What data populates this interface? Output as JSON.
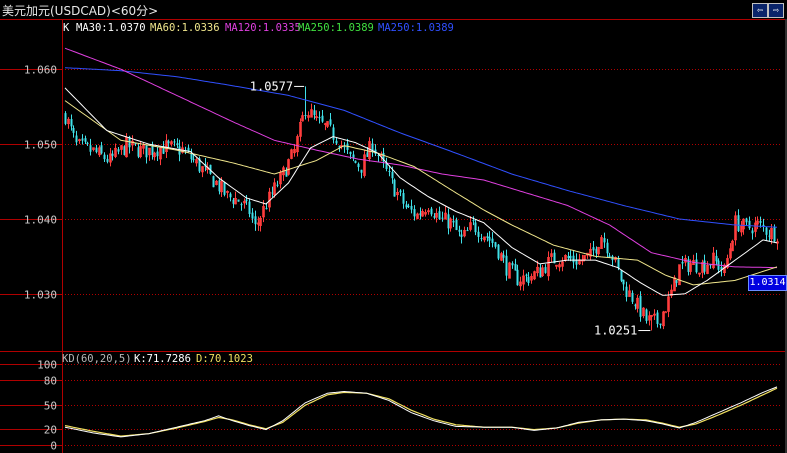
{
  "window": {
    "title": "美元加元(USDCAD)<60分>",
    "btn_prev": "⇦",
    "btn_next": "⇨"
  },
  "colors": {
    "background": "#000000",
    "frame": "#b00000",
    "up_candle": "#ff3d3d",
    "down_candle": "#40e0e8",
    "ma30": "#ffffff",
    "ma60": "#f0e68c",
    "ma120": "#e040e0",
    "ma250": "#3050ff",
    "k_line": "#ffffff",
    "d_line": "#f0e060"
  },
  "main_legend": {
    "prefix": "K",
    "ma30": "MA30:1.0370",
    "ma60": "MA60:1.0336",
    "ma120": "MA120:1.0335",
    "ma250_green": "MA250:1.0389",
    "ma250_blue": "MA250:1.0389"
  },
  "kd_legend": {
    "name": "KD(60,20,5)",
    "k": "K:71.7286",
    "d": "D:70.1023"
  },
  "price_tag": "1.0314",
  "annotations": {
    "high": "1.0577",
    "low": "1.0251"
  },
  "chart_data": [
    {
      "type": "candlestick",
      "title": "",
      "y_ticks": [
        "1.060",
        "1.050",
        "1.040",
        "1.030"
      ],
      "ylim": [
        1.0225,
        1.0643
      ],
      "grid": true,
      "marked_high": 1.0577,
      "marked_low": 1.0251,
      "last_price": 1.0314,
      "close_path_points": [
        [
          0,
          1.0538
        ],
        [
          4,
          1.0498
        ],
        [
          10,
          1.049
        ],
        [
          16,
          1.0478
        ],
        [
          22,
          1.0498
        ],
        [
          28,
          1.049
        ],
        [
          36,
          1.0496
        ],
        [
          42,
          1.0492
        ],
        [
          48,
          1.047
        ],
        [
          54,
          1.0448
        ],
        [
          58,
          1.043
        ],
        [
          62,
          1.0425
        ],
        [
          66,
          1.041
        ],
        [
          68,
          1.0388
        ],
        [
          72,
          1.042
        ],
        [
          78,
          1.046
        ],
        [
          82,
          1.049
        ],
        [
          86,
          1.0548
        ],
        [
          90,
          1.053
        ],
        [
          94,
          1.052
        ],
        [
          98,
          1.0505
        ],
        [
          102,
          1.048
        ],
        [
          106,
          1.047
        ],
        [
          110,
          1.05
        ],
        [
          114,
          1.047
        ],
        [
          118,
          1.044
        ],
        [
          122,
          1.0415
        ],
        [
          126,
          1.0405
        ],
        [
          130,
          1.042
        ],
        [
          134,
          1.04
        ],
        [
          138,
          1.0395
        ],
        [
          142,
          1.0372
        ],
        [
          146,
          1.0392
        ],
        [
          150,
          1.038
        ],
        [
          154,
          1.0365
        ],
        [
          158,
          1.0335
        ],
        [
          162,
          1.032
        ],
        [
          166,
          1.0322
        ],
        [
          170,
          1.033
        ],
        [
          174,
          1.0345
        ],
        [
          178,
          1.0348
        ],
        [
          184,
          1.0344
        ],
        [
          188,
          1.035
        ],
        [
          192,
          1.0378
        ],
        [
          196,
          1.035
        ],
        [
          200,
          1.031
        ],
        [
          204,
          1.029
        ],
        [
          208,
          1.0265
        ],
        [
          212,
          1.0262
        ],
        [
          216,
          1.029
        ],
        [
          220,
          1.0335
        ],
        [
          224,
          1.034
        ],
        [
          228,
          1.0338
        ],
        [
          232,
          1.0345
        ],
        [
          236,
          1.033
        ],
        [
          240,
          1.0395
        ],
        [
          244,
          1.0388
        ],
        [
          248,
          1.0392
        ],
        [
          252,
          1.0383
        ],
        [
          255,
          1.038
        ]
      ],
      "ma30": [
        [
          0,
          1.0575
        ],
        [
          15,
          1.0518
        ],
        [
          30,
          1.05
        ],
        [
          45,
          1.049
        ],
        [
          55,
          1.0455
        ],
        [
          65,
          1.0428
        ],
        [
          72,
          1.042
        ],
        [
          80,
          1.0448
        ],
        [
          88,
          1.0495
        ],
        [
          96,
          1.051
        ],
        [
          104,
          1.0502
        ],
        [
          112,
          1.0488
        ],
        [
          120,
          1.0455
        ],
        [
          130,
          1.043
        ],
        [
          140,
          1.041
        ],
        [
          150,
          1.0395
        ],
        [
          160,
          1.0362
        ],
        [
          170,
          1.034
        ],
        [
          180,
          1.0345
        ],
        [
          190,
          1.0345
        ],
        [
          198,
          1.0335
        ],
        [
          206,
          1.0315
        ],
        [
          214,
          1.0298
        ],
        [
          222,
          1.03
        ],
        [
          230,
          1.0318
        ],
        [
          240,
          1.0345
        ],
        [
          250,
          1.0372
        ],
        [
          255,
          1.0368
        ]
      ],
      "ma60": [
        [
          0,
          1.0558
        ],
        [
          20,
          1.0505
        ],
        [
          40,
          1.0492
        ],
        [
          60,
          1.0475
        ],
        [
          75,
          1.046
        ],
        [
          90,
          1.0478
        ],
        [
          100,
          1.0498
        ],
        [
          112,
          1.0488
        ],
        [
          125,
          1.047
        ],
        [
          140,
          1.0435
        ],
        [
          150,
          1.0412
        ],
        [
          160,
          1.0392
        ],
        [
          175,
          1.0365
        ],
        [
          190,
          1.035
        ],
        [
          205,
          1.0345
        ],
        [
          215,
          1.0325
        ],
        [
          225,
          1.0312
        ],
        [
          240,
          1.0318
        ],
        [
          255,
          1.0336
        ]
      ],
      "ma120": [
        [
          0,
          1.0628
        ],
        [
          20,
          1.06
        ],
        [
          40,
          1.0565
        ],
        [
          60,
          1.053
        ],
        [
          75,
          1.0505
        ],
        [
          90,
          1.0492
        ],
        [
          105,
          1.048
        ],
        [
          120,
          1.0472
        ],
        [
          135,
          1.046
        ],
        [
          150,
          1.0452
        ],
        [
          165,
          1.0435
        ],
        [
          180,
          1.0418
        ],
        [
          195,
          1.0392
        ],
        [
          210,
          1.0355
        ],
        [
          225,
          1.0342
        ],
        [
          240,
          1.0336
        ],
        [
          255,
          1.0335
        ]
      ],
      "ma250": [
        [
          0,
          1.0602
        ],
        [
          20,
          1.0598
        ],
        [
          40,
          1.059
        ],
        [
          60,
          1.0578
        ],
        [
          80,
          1.0565
        ],
        [
          100,
          1.0545
        ],
        [
          120,
          1.0515
        ],
        [
          140,
          1.0488
        ],
        [
          160,
          1.046
        ],
        [
          180,
          1.0438
        ],
        [
          200,
          1.0418
        ],
        [
          220,
          1.04
        ],
        [
          240,
          1.0392
        ],
        [
          255,
          1.0389
        ]
      ]
    },
    {
      "type": "line",
      "title": "",
      "y_ticks": [
        "100",
        "80",
        "50",
        "20",
        "0"
      ],
      "ylim": [
        0,
        100
      ],
      "grid": true,
      "series": [
        {
          "name": "K",
          "points": [
            [
              0,
              22
            ],
            [
              10,
              15
            ],
            [
              20,
              10
            ],
            [
              30,
              14
            ],
            [
              40,
              22
            ],
            [
              50,
              30
            ],
            [
              55,
              36
            ],
            [
              60,
              30
            ],
            [
              66,
              24
            ],
            [
              72,
              19
            ],
            [
              78,
              30
            ],
            [
              86,
              52
            ],
            [
              94,
              64
            ],
            [
              100,
              66
            ],
            [
              108,
              64
            ],
            [
              116,
              55
            ],
            [
              124,
              40
            ],
            [
              132,
              30
            ],
            [
              140,
              23
            ],
            [
              150,
              22
            ],
            [
              160,
              22
            ],
            [
              168,
              18
            ],
            [
              176,
              21
            ],
            [
              184,
              28
            ],
            [
              192,
              31
            ],
            [
              200,
              32
            ],
            [
              208,
              30
            ],
            [
              214,
              26
            ],
            [
              220,
              21
            ],
            [
              226,
              28
            ],
            [
              234,
              40
            ],
            [
              242,
              52
            ],
            [
              250,
              65
            ],
            [
              255,
              71.7
            ]
          ]
        },
        {
          "name": "D",
          "points": [
            [
              0,
              24
            ],
            [
              10,
              17
            ],
            [
              20,
              11
            ],
            [
              30,
              14
            ],
            [
              40,
              21
            ],
            [
              50,
              29
            ],
            [
              55,
              34
            ],
            [
              60,
              31
            ],
            [
              66,
              25
            ],
            [
              72,
              20
            ],
            [
              78,
              28
            ],
            [
              86,
              49
            ],
            [
              94,
              62
            ],
            [
              100,
              65
            ],
            [
              108,
              64
            ],
            [
              116,
              57
            ],
            [
              124,
              43
            ],
            [
              132,
              32
            ],
            [
              140,
              25
            ],
            [
              150,
              22
            ],
            [
              160,
              22
            ],
            [
              168,
              19
            ],
            [
              176,
              21
            ],
            [
              184,
              27
            ],
            [
              192,
              31
            ],
            [
              200,
              32
            ],
            [
              208,
              31
            ],
            [
              214,
              27
            ],
            [
              220,
              22
            ],
            [
              226,
              26
            ],
            [
              234,
              37
            ],
            [
              242,
              49
            ],
            [
              250,
              62
            ],
            [
              255,
              70.1
            ]
          ]
        }
      ]
    }
  ]
}
